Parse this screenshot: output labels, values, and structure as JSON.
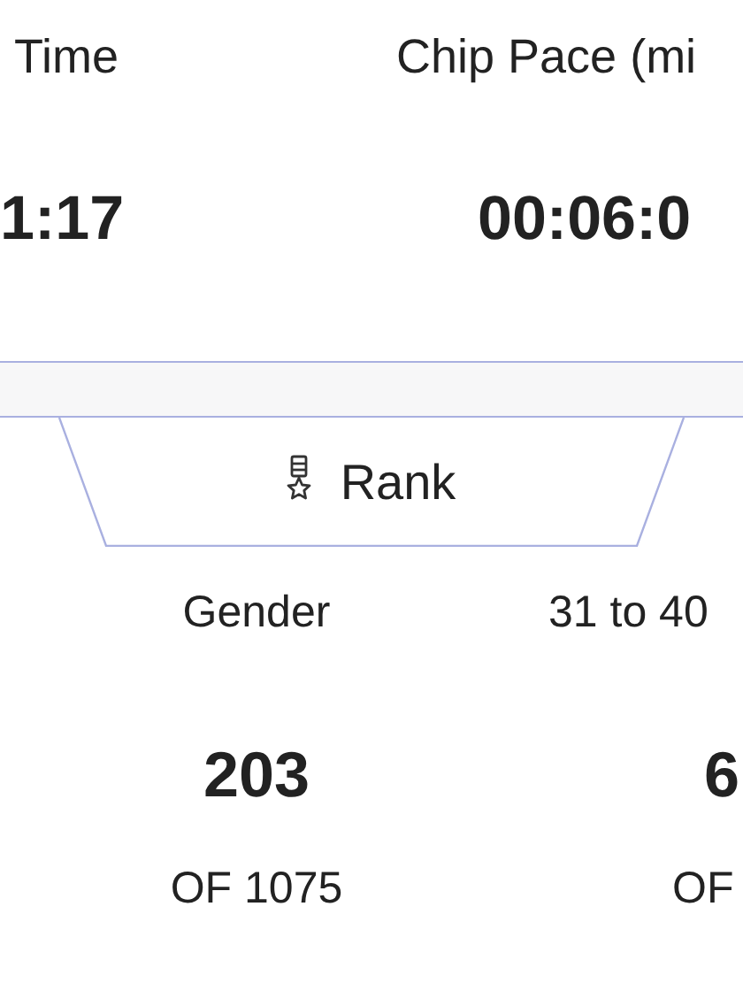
{
  "stats": [
    {
      "label": "Time",
      "value": "1:17"
    },
    {
      "label": "Chip Pace (mi",
      "value": "00:06:0"
    }
  ],
  "tab": {
    "label": "Rank",
    "selected": true
  },
  "ranks": [
    {
      "label": "Gender",
      "value": "203",
      "total": "OF 1075"
    },
    {
      "label": "31 to 40",
      "value": "6",
      "total": "OF"
    }
  ]
}
